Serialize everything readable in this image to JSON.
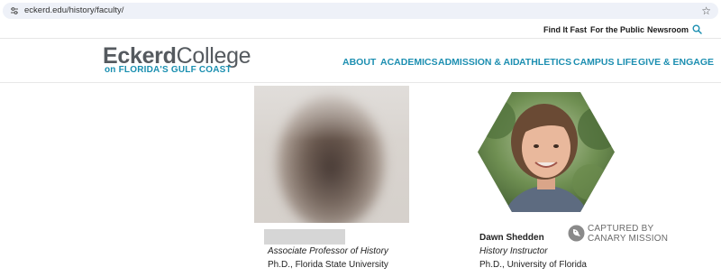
{
  "browser": {
    "url": "eckerd.edu/history/faculty/",
    "site_info_icon": "tune-icon",
    "bookmark_icon": "star-icon"
  },
  "utility_nav": {
    "links": [
      "Find It Fast",
      "For the Public",
      "Newsroom"
    ],
    "search_icon": "search-icon"
  },
  "logo": {
    "word1": "Eckerd",
    "word2": "College",
    "tagline": "on FLORIDA'S GULF COAST"
  },
  "main_nav": {
    "items": [
      "ABOUT",
      "ACADEMICS",
      "ADMISSION & AID",
      "ATHLETICS",
      "CAMPUS LIFE",
      "GIVE & ENGAGE"
    ]
  },
  "faculty": [
    {
      "name": "",
      "title": "Associate Professor of History",
      "degree": "Ph.D., Florida State University",
      "photo": "blurred-portrait"
    },
    {
      "name": "Dawn Shedden",
      "title": "History Instructor",
      "degree": "Ph.D., University of Florida",
      "photo": "hexagon-portrait"
    }
  ],
  "watermark": {
    "line1": "CAPTURED BY",
    "line2": "CANARY MISSION"
  },
  "colors": {
    "brand_teal": "#1d8fb1",
    "logo_gray": "#555a5f",
    "address_bar_bg": "#eef1f8"
  }
}
